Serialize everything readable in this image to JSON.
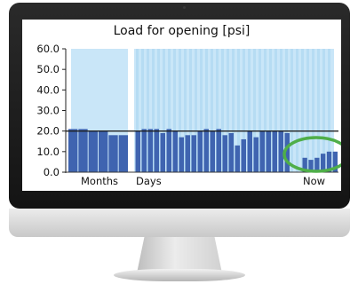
{
  "chart_data": {
    "type": "bar",
    "title": "Load for opening [psi]",
    "yticks": [
      "60.0",
      "50.0",
      "40.0",
      "30.0",
      "20.0",
      "10.0",
      "0.0"
    ],
    "ylim": [
      0,
      60
    ],
    "xlabels": [
      "Months",
      "Days",
      "Now"
    ],
    "threshold": 20,
    "values": [
      21,
      21,
      20,
      20,
      18,
      18,
      20,
      21,
      21,
      21,
      19,
      21,
      20,
      17,
      18,
      18,
      20,
      21,
      20,
      21,
      18,
      19,
      13,
      16,
      20,
      17,
      20,
      20,
      20,
      20,
      19,
      7,
      6,
      7,
      9,
      10,
      10
    ],
    "colors": {
      "bar": "#3f64b0",
      "background_band": "#c9e6f8",
      "threshold_line": "#1f1f1f",
      "highlight_circle": "#4fae49"
    }
  }
}
